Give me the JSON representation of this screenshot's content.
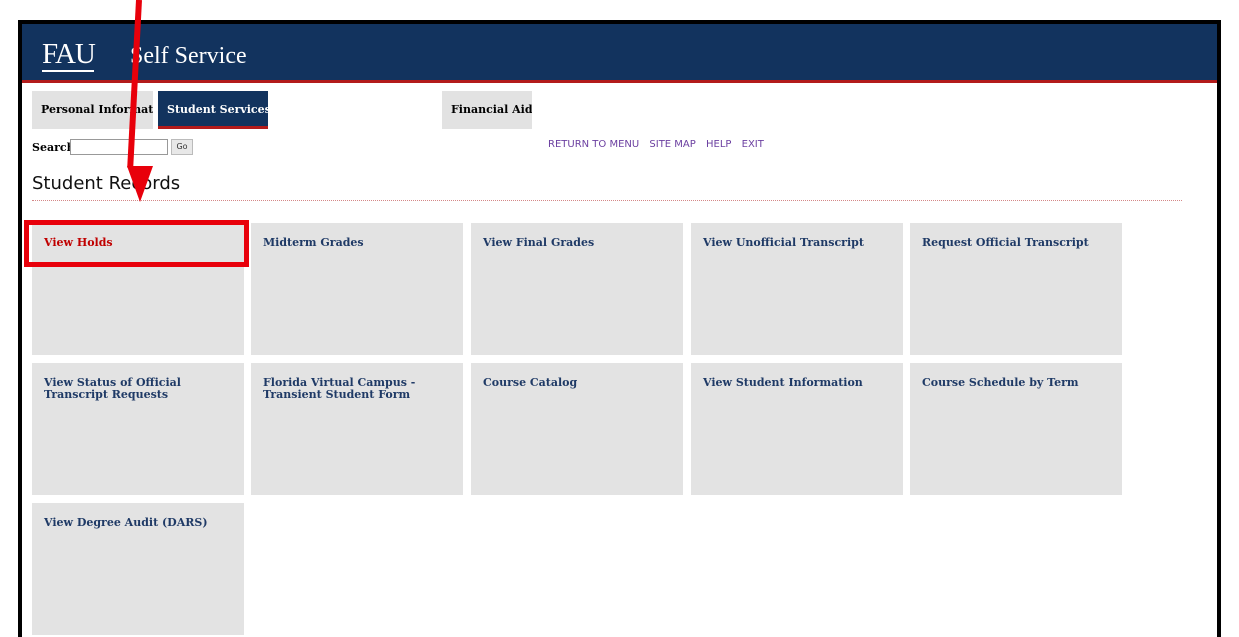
{
  "header": {
    "logo": "FAU",
    "title": "Self Service"
  },
  "tabs": [
    {
      "label": "Personal Information"
    },
    {
      "label": "Student Services"
    },
    {
      "label": "Financial Aid"
    }
  ],
  "search": {
    "label": "Search",
    "value": "",
    "go_label": "Go"
  },
  "toplinks": [
    "RETURN TO MENU",
    "SITE MAP",
    "HELP",
    "EXIT"
  ],
  "page_title": "Student Records",
  "tiles": [
    "View Holds",
    "Midterm Grades",
    "View Final Grades",
    "View Unofficial Transcript",
    "Request Official Transcript",
    "View Status of Official Transcript Requests",
    "Florida Virtual Campus - Transient Student Form",
    "Course Catalog",
    "View Student Information",
    "Course Schedule by Term",
    "View Degree Audit (DARS)"
  ],
  "colors": {
    "brand_navy": "#12335e",
    "accent_red": "#b31b1b",
    "annotation_red": "#e8000b",
    "link_blue": "#1f3a66"
  }
}
